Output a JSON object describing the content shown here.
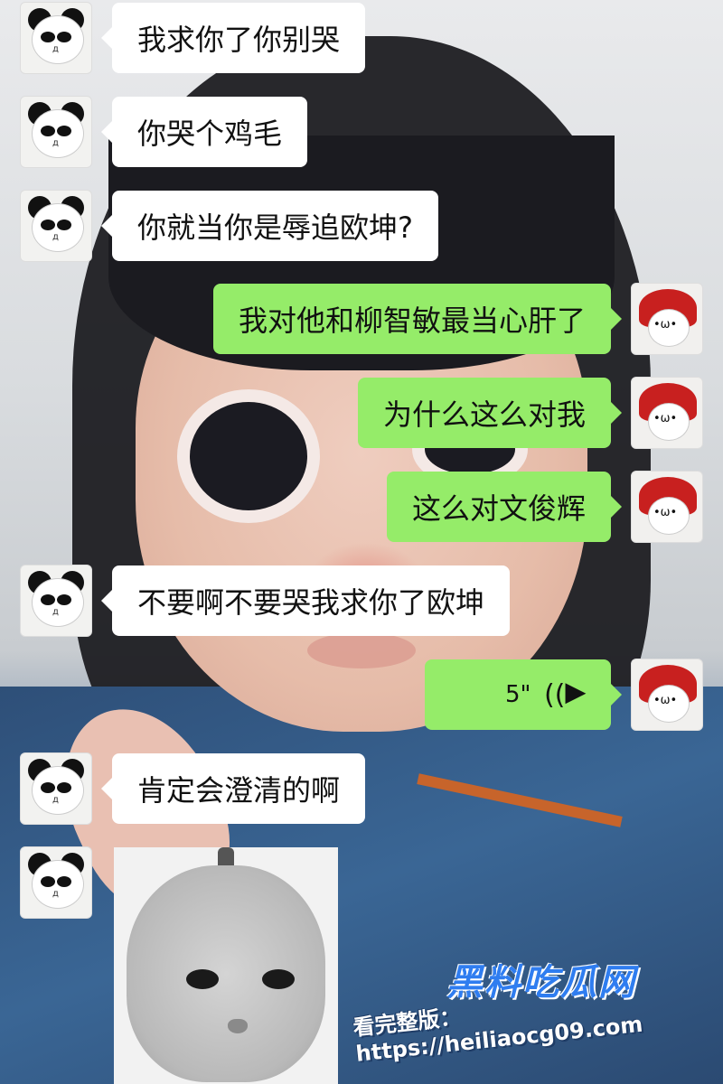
{
  "messages": [
    {
      "side": "in",
      "text": "我求你了你别哭"
    },
    {
      "side": "in",
      "text": "你哭个鸡毛"
    },
    {
      "side": "in",
      "text": "你就当你是辱追欧坤?"
    },
    {
      "side": "out",
      "text": "我对他和柳智敏最当心肝了"
    },
    {
      "side": "out",
      "text": "为什么这么对我"
    },
    {
      "side": "out",
      "text": "这么对文俊辉"
    },
    {
      "side": "in",
      "text": "不要啊不要哭我求你了欧坤"
    },
    {
      "side": "out",
      "type": "voice",
      "duration": "5\""
    },
    {
      "side": "in",
      "text": "肯定会澄清的啊"
    }
  ],
  "avatars": {
    "in": {
      "icon": "panda-avatar-icon",
      "mouth": "д"
    },
    "out": {
      "icon": "red-hat-avatar-icon",
      "face": "•ω•"
    }
  },
  "sticker": {
    "icon": "cat-fruit-sticker"
  },
  "watermark": {
    "brand": "黑料吃瓜网",
    "url": "看完整版： https://heiliaocg09.com"
  },
  "colors": {
    "bubble_in": "#ffffff",
    "bubble_out": "#95ec69",
    "brand_blue": "#2f7df0"
  }
}
